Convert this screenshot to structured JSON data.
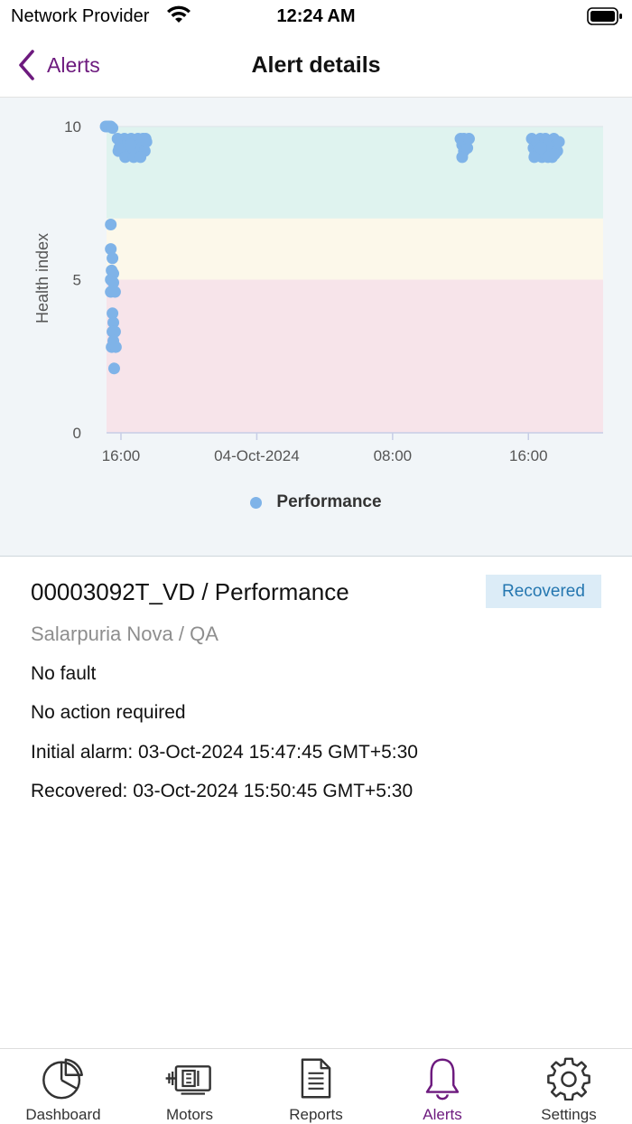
{
  "status_bar": {
    "carrier": "Network Provider",
    "time": "12:24 AM"
  },
  "nav": {
    "back_label": "Alerts",
    "title": "Alert details"
  },
  "chart_data": {
    "type": "scatter",
    "ylabel": "Health index",
    "ylim": [
      0,
      10
    ],
    "yticks": [
      "0",
      "5",
      "10"
    ],
    "x_domain_hours": [
      -0.85,
      28.4
    ],
    "x_domain_note_hidden": true,
    "xticks": [
      {
        "at": 0,
        "label": "16:00"
      },
      {
        "at": 8,
        "label": "04-Oct-2024"
      },
      {
        "at": 16,
        "label": "08:00"
      },
      {
        "at": 24,
        "label": "16:00"
      }
    ],
    "bands": [
      {
        "from": 0,
        "to": 5,
        "color": "#f7e4ea"
      },
      {
        "from": 5,
        "to": 7,
        "color": "#fcf8ea"
      },
      {
        "from": 7,
        "to": 10,
        "color": "#dff3ef"
      }
    ],
    "legend": [
      {
        "name": "Performance",
        "color": "#7fb3e8"
      }
    ],
    "series": [
      {
        "name": "Performance",
        "color": "#7fb3e8",
        "points": [
          [
            -0.9,
            10.0
          ],
          [
            -0.8,
            10.0
          ],
          [
            -0.7,
            10.0
          ],
          [
            -0.6,
            10.0
          ],
          [
            -0.5,
            9.95
          ],
          [
            -0.6,
            6.8
          ],
          [
            -0.6,
            6.0
          ],
          [
            -0.5,
            5.7
          ],
          [
            -0.55,
            5.3
          ],
          [
            -0.45,
            5.2
          ],
          [
            -0.6,
            5.0
          ],
          [
            -0.45,
            4.9
          ],
          [
            -0.6,
            4.6
          ],
          [
            -0.35,
            4.6
          ],
          [
            -0.5,
            3.9
          ],
          [
            -0.45,
            3.6
          ],
          [
            -0.5,
            3.3
          ],
          [
            -0.35,
            3.3
          ],
          [
            -0.45,
            3.0
          ],
          [
            -0.55,
            2.8
          ],
          [
            -0.3,
            2.8
          ],
          [
            -0.4,
            2.1
          ],
          [
            -0.2,
            9.6
          ],
          [
            -0.1,
            9.3
          ],
          [
            0.0,
            9.5
          ],
          [
            0.1,
            9.2
          ],
          [
            0.2,
            9.6
          ],
          [
            0.3,
            9.3
          ],
          [
            0.4,
            9.5
          ],
          [
            0.5,
            9.1
          ],
          [
            0.6,
            9.6
          ],
          [
            0.7,
            9.3
          ],
          [
            0.8,
            9.5
          ],
          [
            0.9,
            9.2
          ],
          [
            1.0,
            9.6
          ],
          [
            1.1,
            9.4
          ],
          [
            1.2,
            9.3
          ],
          [
            1.3,
            9.6
          ],
          [
            1.4,
            9.2
          ],
          [
            1.5,
            9.5
          ],
          [
            -0.15,
            9.2
          ],
          [
            0.25,
            9.0
          ],
          [
            0.75,
            9.0
          ],
          [
            1.15,
            9.0
          ],
          [
            1.45,
            9.6
          ],
          [
            0.55,
            9.4
          ],
          [
            20.0,
            9.6
          ],
          [
            20.1,
            9.4
          ],
          [
            20.2,
            9.2
          ],
          [
            20.1,
            9.0
          ],
          [
            20.3,
            9.5
          ],
          [
            20.4,
            9.3
          ],
          [
            20.2,
            9.6
          ],
          [
            20.5,
            9.6
          ],
          [
            24.2,
            9.6
          ],
          [
            24.3,
            9.3
          ],
          [
            24.4,
            9.1
          ],
          [
            24.5,
            9.5
          ],
          [
            24.6,
            9.2
          ],
          [
            24.7,
            9.6
          ],
          [
            24.8,
            9.0
          ],
          [
            24.9,
            9.4
          ],
          [
            25.0,
            9.6
          ],
          [
            25.1,
            9.2
          ],
          [
            25.2,
            9.5
          ],
          [
            25.3,
            9.3
          ],
          [
            25.4,
            9.0
          ],
          [
            25.5,
            9.6
          ],
          [
            25.6,
            9.4
          ],
          [
            25.7,
            9.2
          ],
          [
            25.8,
            9.5
          ],
          [
            24.35,
            9.0
          ],
          [
            24.75,
            9.3
          ],
          [
            25.15,
            9.0
          ],
          [
            25.55,
            9.1
          ]
        ]
      }
    ]
  },
  "detail": {
    "title": "00003092T_VD / Performance",
    "status": "Recovered",
    "location": "Salarpuria Nova / QA",
    "fault": "No fault",
    "action": "No action required",
    "initial_alarm": "Initial alarm: 03-Oct-2024 15:47:45 GMT+5:30",
    "recovered": "Recovered: 03-Oct-2024 15:50:45 GMT+5:30"
  },
  "tabs": [
    {
      "label": "Dashboard",
      "icon": "pie-chart-icon"
    },
    {
      "label": "Motors",
      "icon": "motor-icon"
    },
    {
      "label": "Reports",
      "icon": "report-icon"
    },
    {
      "label": "Alerts",
      "icon": "bell-icon"
    },
    {
      "label": "Settings",
      "icon": "gear-icon"
    }
  ],
  "colors": {
    "accent": "#6d1a7e",
    "badge_bg": "#dcecf7",
    "badge_text": "#2577b0",
    "point": "#7fb3e8"
  }
}
